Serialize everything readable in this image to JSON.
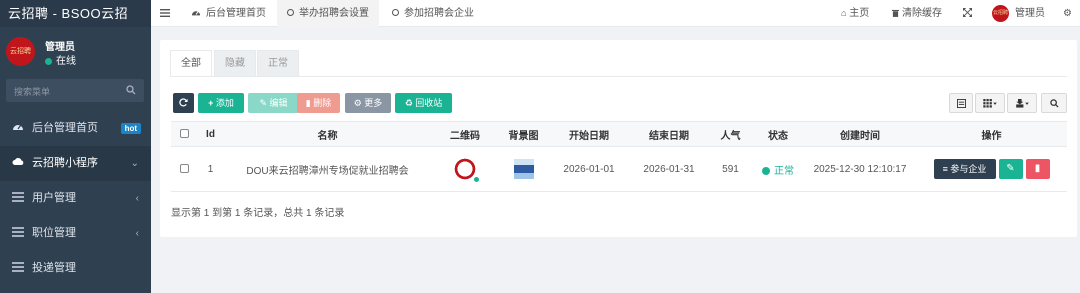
{
  "app": {
    "title": "云招聘 - BSOO云招"
  },
  "user": {
    "name": "管理员",
    "status": "在线",
    "avatar_text": "云招聘"
  },
  "sidebar": {
    "search_placeholder": "搜索菜单",
    "items": [
      {
        "label": "后台管理首页",
        "icon": "gauge-icon",
        "badge": "hot"
      },
      {
        "label": "云招聘小程序",
        "icon": "cloud-icon",
        "arrow": "⌄"
      },
      {
        "label": "用户管理",
        "icon": "list-icon",
        "arrow": "‹"
      },
      {
        "label": "职位管理",
        "icon": "list-icon",
        "arrow": "‹"
      },
      {
        "label": "投递管理",
        "icon": "list-icon"
      }
    ]
  },
  "topbar": {
    "tabs": [
      {
        "label": "后台管理首页",
        "icon": "gauge-icon"
      },
      {
        "label": "举办招聘会设置",
        "icon": "circle-icon"
      },
      {
        "label": "参加招聘会企业",
        "icon": "circle-icon"
      }
    ],
    "home": "主页",
    "clear_cache": "清除缓存",
    "user_label": "管理员"
  },
  "panel": {
    "tabs": [
      "全部",
      "隐藏",
      "正常"
    ],
    "toolbar": {
      "add": "添加",
      "edit": "编辑",
      "delete": "删除",
      "more": "更多",
      "recycle": "回收站"
    }
  },
  "table": {
    "columns": [
      "Id",
      "名称",
      "二维码",
      "背景图",
      "开始日期",
      "结束日期",
      "人气",
      "状态",
      "创建时间",
      "操作"
    ],
    "rows": [
      {
        "id": "1",
        "name": "DOU来云招聘漳州专场促就业招聘会",
        "start": "2026-01-01",
        "end": "2026-01-31",
        "popularity": "591",
        "status": "正常",
        "created": "2025-12-30 12:10:17",
        "join_label": "参与企业"
      }
    ]
  },
  "pager": {
    "text": "显示第 1 到第 1 条记录，总共 1 条记录"
  },
  "colors": {
    "sidebar": "#2f4050",
    "primary": "#1ab394",
    "danger": "#ed5565",
    "info": "#1c84c6"
  }
}
